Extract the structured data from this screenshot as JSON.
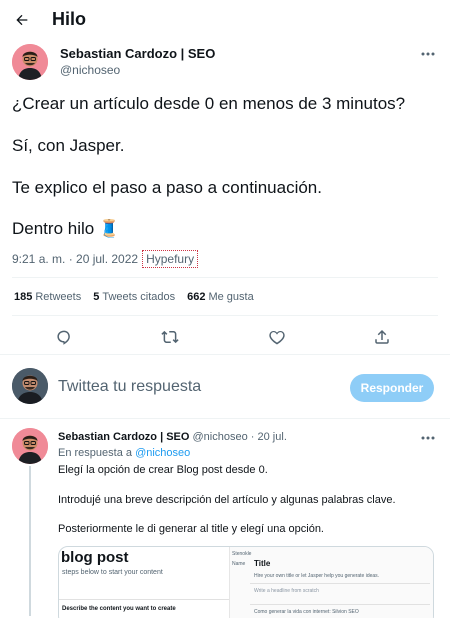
{
  "header": {
    "title": "Hilo"
  },
  "tweet": {
    "author_name": "Sebastian Cardozo | SEO",
    "author_handle": "@nichoseo",
    "paragraphs": [
      "¿Crear un artículo desde 0 en menos de 3 minutos?",
      "Sí, con Jasper.",
      "Te explico el paso a paso a continuación.",
      "Dentro hilo 🧵"
    ],
    "timestamp": "9:21 a. m. · 20 jul. 2022",
    "via": "Hypefury",
    "stats": {
      "retweets_count": "185",
      "retweets_label": "Retweets",
      "quotes_count": "5",
      "quotes_label": "Tweets citados",
      "likes_count": "662",
      "likes_label": "Me gusta"
    }
  },
  "compose": {
    "placeholder": "Twittea tu respuesta",
    "button_label": "Responder"
  },
  "reply": {
    "author_name": "Sebastian Cardozo | SEO",
    "author_handle": "@nichoseo",
    "separator": "·",
    "date": "20 jul.",
    "in_reply_prefix": "En respuesta a",
    "in_reply_handle": "@nichoseo",
    "paragraphs": [
      "Elegí la opción de crear Blog post desde 0.",
      "Introdujé una breve descripción del artículo y algunas palabras clave.",
      "Posteriormente le di generar al title y elegí una opción."
    ]
  },
  "media": {
    "left_title": "blog post",
    "left_subtitle": "steps below to start your content",
    "left_desc": "Describe the content you want to create",
    "right_top": "Stenokle",
    "right_title_prefix": "Name",
    "right_title": "Title",
    "right_line1": "Hire your own title or let Jasper help you generate ideas.",
    "right_line2": "Write a headline from scratch",
    "right_line3": "Como generar la vida con internet: Silvion SEO"
  },
  "colors": {
    "accent": "#1d9bf0",
    "button_disabled": "#8ecdf7",
    "muted_text": "#536471",
    "avatar_bg": "#f08a97"
  }
}
